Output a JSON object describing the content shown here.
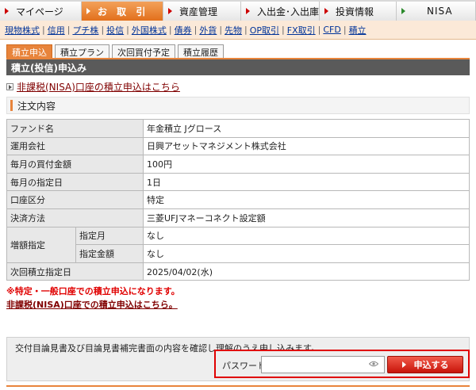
{
  "topnav": {
    "tabs": [
      {
        "label": "マイページ",
        "active": false
      },
      {
        "label": "お 取 引",
        "active": true
      },
      {
        "label": "資産管理",
        "active": false
      },
      {
        "label": "入出金･入出庫",
        "active": false
      },
      {
        "label": "投資情報",
        "active": false
      },
      {
        "label": "NISA",
        "active": false
      }
    ]
  },
  "subnav": {
    "links": [
      "現物株式",
      "信用",
      "プチ株",
      "投信",
      "外国株式",
      "債券",
      "外貨",
      "先物",
      "OP取引",
      "FX取引",
      "CFD",
      "積立"
    ]
  },
  "subtabs": [
    {
      "label": "積立申込",
      "active": true
    },
    {
      "label": "積立プラン",
      "active": false
    },
    {
      "label": "次回買付予定",
      "active": false
    },
    {
      "label": "積立履歴",
      "active": false
    }
  ],
  "section_title": "積立(投信)申込み",
  "nisa_link_top": "非課税(NISA)口座の積立申込はこちら",
  "order_heading": "注文内容",
  "details": {
    "fund_name_label": "ファンド名",
    "fund_name_value": "年金積立 Jグロース",
    "company_label": "運用会社",
    "company_value": "日興アセットマネジメント株式会社",
    "monthly_amount_label": "毎月の買付金額",
    "monthly_amount_value": "100円",
    "monthly_date_label": "毎月の指定日",
    "monthly_date_value": "1日",
    "account_label": "口座区分",
    "account_value": "特定",
    "payment_label": "決済方法",
    "payment_value": "三菱UFJマネーコネクト設定額",
    "increase_label": "増額指定",
    "increase_month_label": "指定月",
    "increase_month_value": "なし",
    "increase_amount_label": "指定金額",
    "increase_amount_value": "なし",
    "next_date_label": "次回積立指定日",
    "next_date_value": "2025/04/02(水)"
  },
  "warning": "※特定・一般口座での積立申込になります。",
  "nisa_link_bottom": "非課税(NISA)口座での積立申込はこちら。",
  "confirm_text": "交付目論見書及び目論見書補完書面の内容を確認し理解のうえ申し込みます。",
  "password": {
    "label": "パスワード",
    "value": "",
    "placeholder": ""
  },
  "submit_label": "申込する",
  "colors": {
    "accent_orange": "#e8843b",
    "submit_red": "#d81e10",
    "warning_red": "#e00000",
    "link_maroon": "#800000",
    "link_blue": "#003399"
  }
}
